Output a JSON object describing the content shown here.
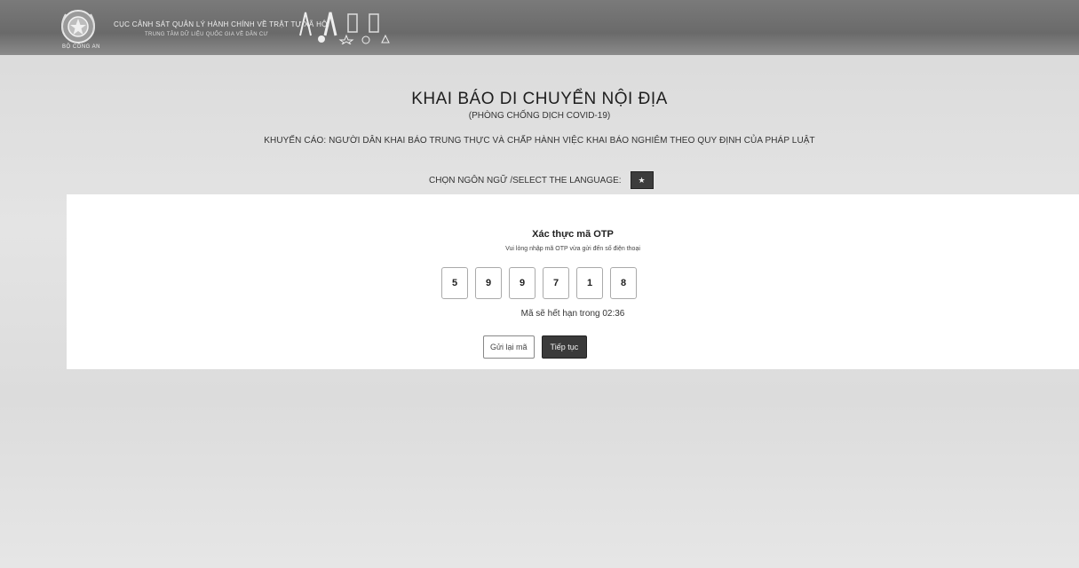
{
  "header": {
    "logo_caption": "BỘ CÔNG AN",
    "org_title": "CỤC CẢNH SÁT QUẢN LÝ HÀNH CHÍNH VỀ TRẬT TỰ XÃ HỘI",
    "org_subtitle": "TRUNG TÂM DỮ LIỆU QUỐC GIA VỀ DÂN CƯ"
  },
  "page": {
    "title": "KHAI BÁO DI CHUYỂN NỘI ĐỊA",
    "subtitle": "(PHÒNG CHỐNG DỊCH COVID-19)",
    "warning": "KHUYẾN CÁO: NGƯỜI DÂN KHAI BÁO TRUNG THỰC VÀ CHẤP HÀNH VIỆC KHAI BÁO NGHIÊM THEO QUY ĐỊNH CỦA PHÁP LUẬT",
    "language_label": "CHỌN NGÔN NGỮ /SELECT THE LANGUAGE:",
    "language_flag": "★"
  },
  "otp": {
    "title": "Xác thực mã OTP",
    "description": "Vui lòng nhập mã OTP vừa gửi đến số điện thoại",
    "digits": [
      "5",
      "9",
      "9",
      "7",
      "1",
      "8"
    ],
    "expiry_text": "Mã sẽ hết hạn trong 02:36",
    "resend_label": "Gửi lại mã",
    "continue_label": "Tiếp tục"
  }
}
